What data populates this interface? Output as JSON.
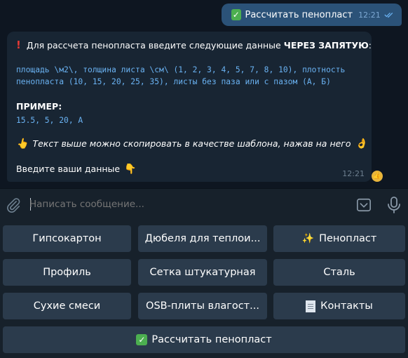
{
  "chat": {
    "outgoing": {
      "text": "Рассчитать пенопласт",
      "time": "12:21"
    },
    "incoming": {
      "line1_prefix": "Для рассчета пенопласта введите следующие данные ",
      "line1_bold": "ЧЕРЕЗ ЗАПЯТУЮ",
      "line1_suffix": ":",
      "template_line1": "площадь \\м2\\, толщина листа \\см\\ (1, 2, 3, 4, 5, 7, 8, 10), плотность",
      "template_line2": "пенопласта (10, 15, 20, 25, 35), листы без паза или с пазом (А, Б)",
      "example_label": "ПРИМЕР:",
      "example_value": "15.5, 5, 20, A",
      "hint": "Текст выше можно скопировать в качестве шаблона, нажав на него",
      "prompt": "Введите ваши данные",
      "time": "12:21"
    }
  },
  "compose": {
    "placeholder": "Написать сообщение..."
  },
  "keyboard": {
    "row1": [
      "Гипсокартон",
      "Дюбеля для теплои...",
      "Пенопласт"
    ],
    "row2": [
      "Профиль",
      "Сетка штукатурная",
      "Сталь"
    ],
    "row3": [
      "Сухие смеси",
      "OSB-плиты влагост...",
      "Контакты"
    ],
    "row4": "Рассчитать пенопласт"
  },
  "colors": {
    "background": "#0e1621",
    "outgoing_bubble": "#2b5278",
    "incoming_bubble": "#182533",
    "button": "#2b3b4c",
    "link_mono": "#6ab2f2"
  }
}
